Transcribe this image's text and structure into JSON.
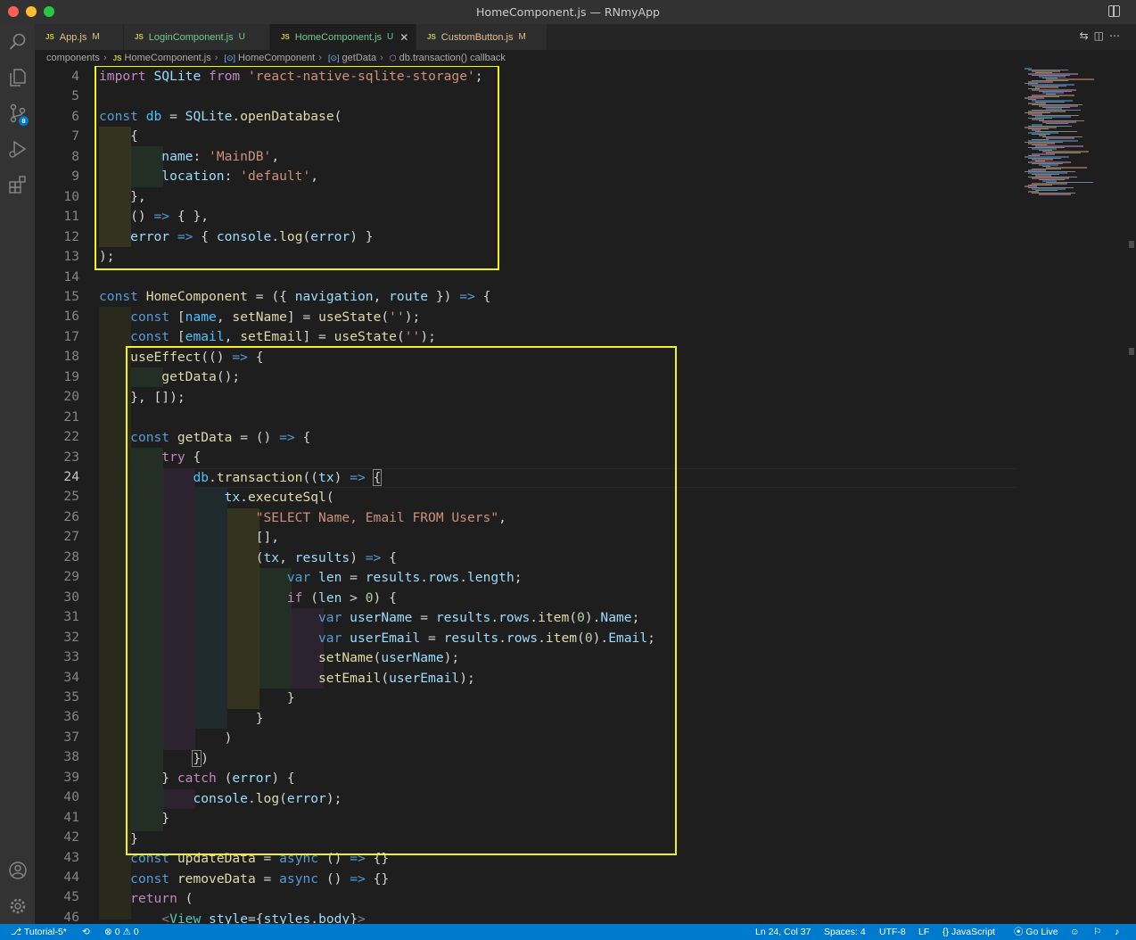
{
  "window": {
    "title": "HomeComponent.js — RNmyApp"
  },
  "activity_bar": {
    "items": [
      {
        "icon": "search-icon"
      },
      {
        "icon": "files-icon"
      },
      {
        "icon": "source-control-icon",
        "badge": "8"
      },
      {
        "icon": "run-debug-icon"
      },
      {
        "icon": "extensions-icon"
      }
    ],
    "bottom": [
      {
        "icon": "account-icon"
      },
      {
        "icon": "settings-gear-icon"
      }
    ]
  },
  "tabs": [
    {
      "icon_text": "JS",
      "label": "App.js",
      "status": "M"
    },
    {
      "icon_text": "JS",
      "label": "LoginComponent.js",
      "status": "U"
    },
    {
      "icon_text": "JS",
      "label": "HomeComponent.js",
      "status": "U",
      "close": "✕"
    },
    {
      "icon_text": "JS",
      "label": "CustomButton.js",
      "status": "M"
    }
  ],
  "breadcrumb": {
    "folder": "components",
    "file_icon": "JS",
    "file": "HomeComponent.js",
    "symbol1_icon": "[⊙]",
    "symbol1": "HomeComponent",
    "symbol2_icon": "[⊙]",
    "symbol2": "getData",
    "symbol3_icon": "⬡",
    "symbol3": "db.transaction() callback"
  },
  "editor": {
    "current_line": 24,
    "line_numbers": [
      "4",
      "5",
      "6",
      "7",
      "8",
      "9",
      "10",
      "11",
      "12",
      "13",
      "14",
      "15",
      "16",
      "17",
      "18",
      "19",
      "20",
      "21",
      "22",
      "23",
      "24",
      "25",
      "26",
      "27",
      "28",
      "29",
      "30",
      "31",
      "32",
      "33",
      "34",
      "35",
      "36",
      "37",
      "38",
      "39",
      "40",
      "41",
      "42",
      "43",
      "44",
      "45",
      "46"
    ]
  },
  "statusbar": {
    "branch": "Tutorial-5*",
    "errors": "0",
    "warnings": "0",
    "position": "Ln 24, Col 37",
    "spaces": "Spaces: 4",
    "encoding": "UTF-8",
    "eol": "LF",
    "language_icon": "{}",
    "language": "JavaScript",
    "golive": "Go Live"
  },
  "colors": {
    "accent": "#007acc",
    "highlight_box": "#f3f316"
  }
}
